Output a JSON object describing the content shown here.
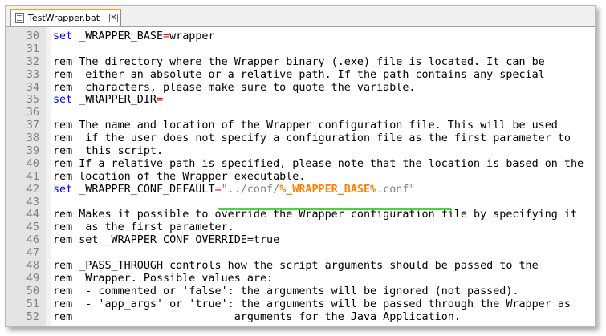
{
  "tab": {
    "label": "TestWrapper.bat",
    "close_glyph": "✕"
  },
  "lines": [
    {
      "num": "30",
      "parts": [
        {
          "t": "set",
          "c": "kw"
        },
        {
          "t": " _WRAPPER_BASE"
        },
        {
          "t": "=",
          "c": "op"
        },
        {
          "t": "wrapper"
        }
      ]
    },
    {
      "num": "31",
      "parts": []
    },
    {
      "num": "32",
      "parts": [
        {
          "t": "rem The directory where the Wrapper binary (.exe) file is located. It can be"
        }
      ]
    },
    {
      "num": "33",
      "parts": [
        {
          "t": "rem  either an absolute or a relative path. If the path contains any special"
        }
      ]
    },
    {
      "num": "34",
      "parts": [
        {
          "t": "rem  characters, please make sure to quote the variable."
        }
      ]
    },
    {
      "num": "35",
      "parts": [
        {
          "t": "set",
          "c": "kw"
        },
        {
          "t": " _WRAPPER_DIR"
        },
        {
          "t": "=",
          "c": "op"
        }
      ]
    },
    {
      "num": "36",
      "parts": []
    },
    {
      "num": "37",
      "parts": [
        {
          "t": "rem The name and location of the Wrapper configuration file. This will be used"
        }
      ]
    },
    {
      "num": "38",
      "parts": [
        {
          "t": "rem  if the user does not specify a configuration file as the first parameter to"
        }
      ]
    },
    {
      "num": "39",
      "parts": [
        {
          "t": "rem  this script."
        }
      ]
    },
    {
      "num": "40",
      "parts": [
        {
          "t": "rem If a relative path is specified, please note that the location is based on the"
        }
      ]
    },
    {
      "num": "41",
      "parts": [
        {
          "t": "rem location of the Wrapper executable."
        }
      ]
    },
    {
      "num": "42",
      "parts": [
        {
          "t": "set",
          "c": "kw"
        },
        {
          "t": " _WRAPPER_CONF_DEFAULT"
        },
        {
          "t": "=",
          "c": "op"
        },
        {
          "t": "\"../conf/",
          "c": "str"
        },
        {
          "t": "%_WRAPPER_BASE%",
          "c": "var"
        },
        {
          "t": ".conf\"",
          "c": "str"
        }
      ]
    },
    {
      "num": "43",
      "parts": []
    },
    {
      "num": "44",
      "parts": [
        {
          "t": "rem Makes it possible to override the Wrapper configuration file by specifying it"
        }
      ]
    },
    {
      "num": "45",
      "parts": [
        {
          "t": "rem  as the first parameter."
        }
      ]
    },
    {
      "num": "46",
      "parts": [
        {
          "t": "rem set _WRAPPER_CONF_OVERRIDE=true"
        }
      ]
    },
    {
      "num": "47",
      "parts": []
    },
    {
      "num": "48",
      "parts": [
        {
          "t": "rem _PASS_THROUGH controls how the script arguments should be passed to the"
        }
      ]
    },
    {
      "num": "49",
      "parts": [
        {
          "t": "rem  Wrapper. Possible values are:"
        }
      ]
    },
    {
      "num": "50",
      "parts": [
        {
          "t": "rem  - commented or 'false': the arguments will be ignored (not passed)."
        }
      ]
    },
    {
      "num": "51",
      "parts": [
        {
          "t": "rem  - 'app_args' or 'true': the arguments will be passed through the Wrapper as"
        }
      ]
    },
    {
      "num": "52",
      "parts": [
        {
          "t": "rem                         arguments for the Java Application."
        }
      ]
    }
  ],
  "colors": {
    "keyword": "#0000ff",
    "operator": "#ff0000",
    "string": "#808080",
    "variable": "#ff8000",
    "highlight_underline": "#44d444"
  }
}
